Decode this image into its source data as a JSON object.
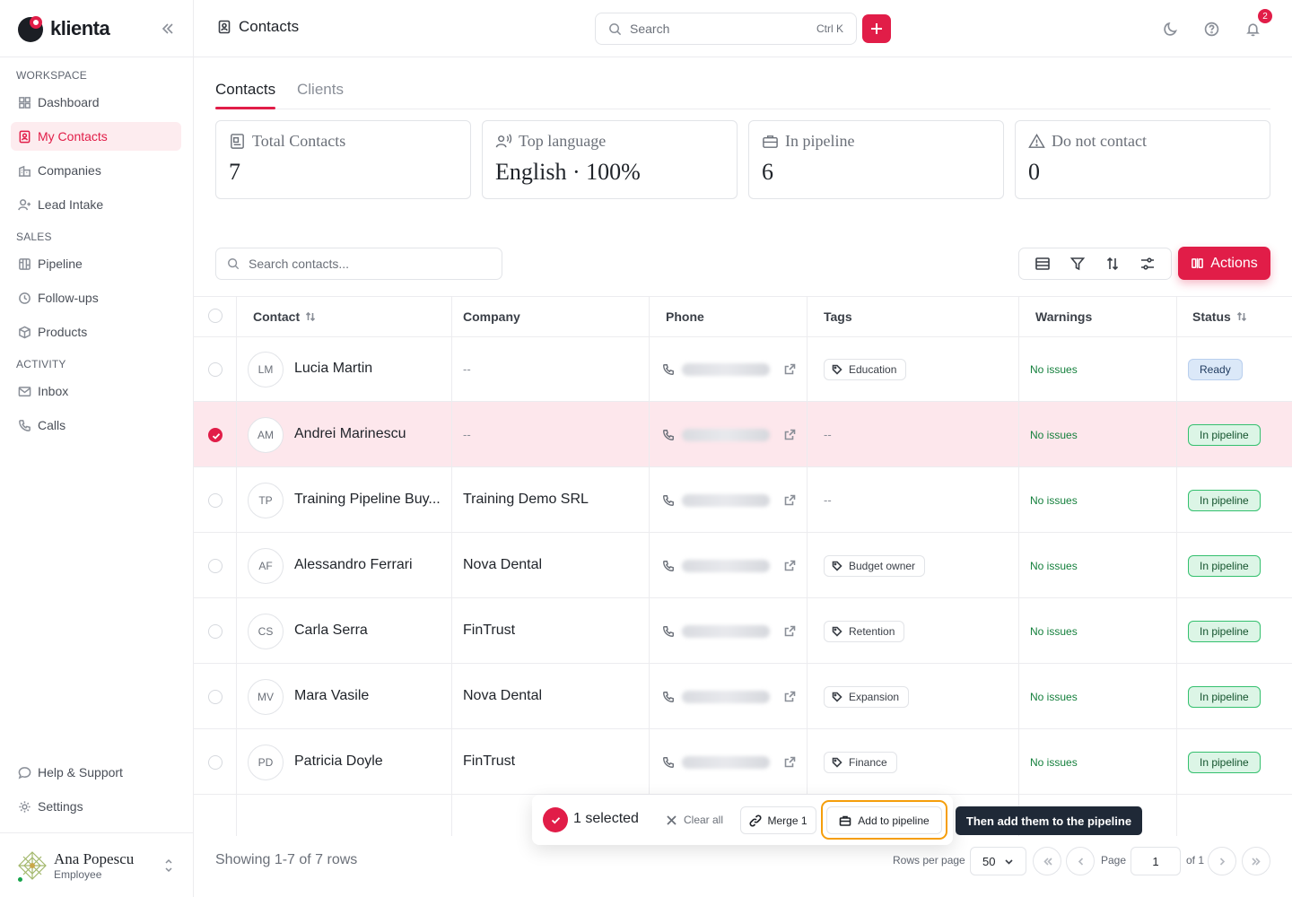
{
  "app": {
    "brand": "klienta"
  },
  "sidebar": {
    "sections": {
      "workspace": "WORKSPACE",
      "sales": "SALES",
      "activity": "ACTIVITY"
    },
    "items": [
      {
        "label": "Dashboard",
        "icon": "grid-icon"
      },
      {
        "label": "My Contacts",
        "icon": "contact-icon",
        "active": true
      },
      {
        "label": "Companies",
        "icon": "building-icon"
      },
      {
        "label": "Lead Intake",
        "icon": "user-plus-icon"
      },
      {
        "label": "Pipeline",
        "icon": "kanban-icon"
      },
      {
        "label": "Follow-ups",
        "icon": "clock-icon"
      },
      {
        "label": "Products",
        "icon": "box-icon"
      },
      {
        "label": "Inbox",
        "icon": "mail-icon"
      },
      {
        "label": "Calls",
        "icon": "phone-icon"
      }
    ],
    "footer_items": [
      {
        "label": "Help & Support",
        "icon": "chat-icon"
      },
      {
        "label": "Settings",
        "icon": "gear-icon"
      }
    ],
    "user": {
      "name": "Ana Popescu",
      "role": "Employee"
    }
  },
  "header": {
    "title": "Contacts",
    "search_placeholder": "Search",
    "search_shortcut": "Ctrl K",
    "notification_count": "2"
  },
  "tabs": [
    {
      "label": "Contacts",
      "active": true
    },
    {
      "label": "Clients",
      "active": false
    }
  ],
  "stats": [
    {
      "label": "Total Contacts",
      "value": "7",
      "icon": "contact-card-icon"
    },
    {
      "label": "Top language",
      "value": "English · 100%",
      "icon": "speaking-icon"
    },
    {
      "label": "In pipeline",
      "value": "6",
      "icon": "briefcase-icon"
    },
    {
      "label": "Do not contact",
      "value": "0",
      "icon": "warning-icon"
    }
  ],
  "toolbar": {
    "search_placeholder": "Search contacts...",
    "actions_label": "Actions"
  },
  "table": {
    "columns": [
      "Contact",
      "Company",
      "Phone",
      "Tags",
      "Warnings",
      "Status"
    ],
    "rows": [
      {
        "initials": "LM",
        "name": "Lucia Martin",
        "company": "--",
        "tag": "Education",
        "warnings": "No issues",
        "status": "Ready",
        "selected": false
      },
      {
        "initials": "AM",
        "name": "Andrei Marinescu",
        "company": "--",
        "tag": "--",
        "warnings": "No issues",
        "status": "In pipeline",
        "selected": true
      },
      {
        "initials": "TP",
        "name": "Training Pipeline Buy...",
        "company": "Training Demo SRL",
        "tag": "--",
        "warnings": "No issues",
        "status": "In pipeline",
        "selected": false
      },
      {
        "initials": "AF",
        "name": "Alessandro Ferrari",
        "company": "Nova Dental",
        "tag": "Budget owner",
        "warnings": "No issues",
        "status": "In pipeline",
        "selected": false
      },
      {
        "initials": "CS",
        "name": "Carla Serra",
        "company": "FinTrust",
        "tag": "Retention",
        "warnings": "No issues",
        "status": "In pipeline",
        "selected": false
      },
      {
        "initials": "MV",
        "name": "Mara Vasile",
        "company": "Nova Dental",
        "tag": "Expansion",
        "warnings": "No issues",
        "status": "In pipeline",
        "selected": false
      },
      {
        "initials": "PD",
        "name": "Patricia Doyle",
        "company": "FinTrust",
        "tag": "Finance",
        "warnings": "No issues",
        "status": "In pipeline",
        "selected": false
      }
    ]
  },
  "selection_bar": {
    "count_label": "1 selected",
    "clear_label": "Clear all",
    "merge_label": "Merge 1",
    "add_pipeline_label": "Add to pipeline",
    "tooltip": "Then add them to the pipeline"
  },
  "footer": {
    "summary": "Showing 1-7 of 7 rows",
    "rows_per_page_label": "Rows per page",
    "rows_per_page": "50",
    "page_label": "Page",
    "page": "1",
    "of_label": "of 1"
  },
  "colors": {
    "accent": "#e11d48",
    "success": "#15803d",
    "highlight": "#f59e0b"
  }
}
